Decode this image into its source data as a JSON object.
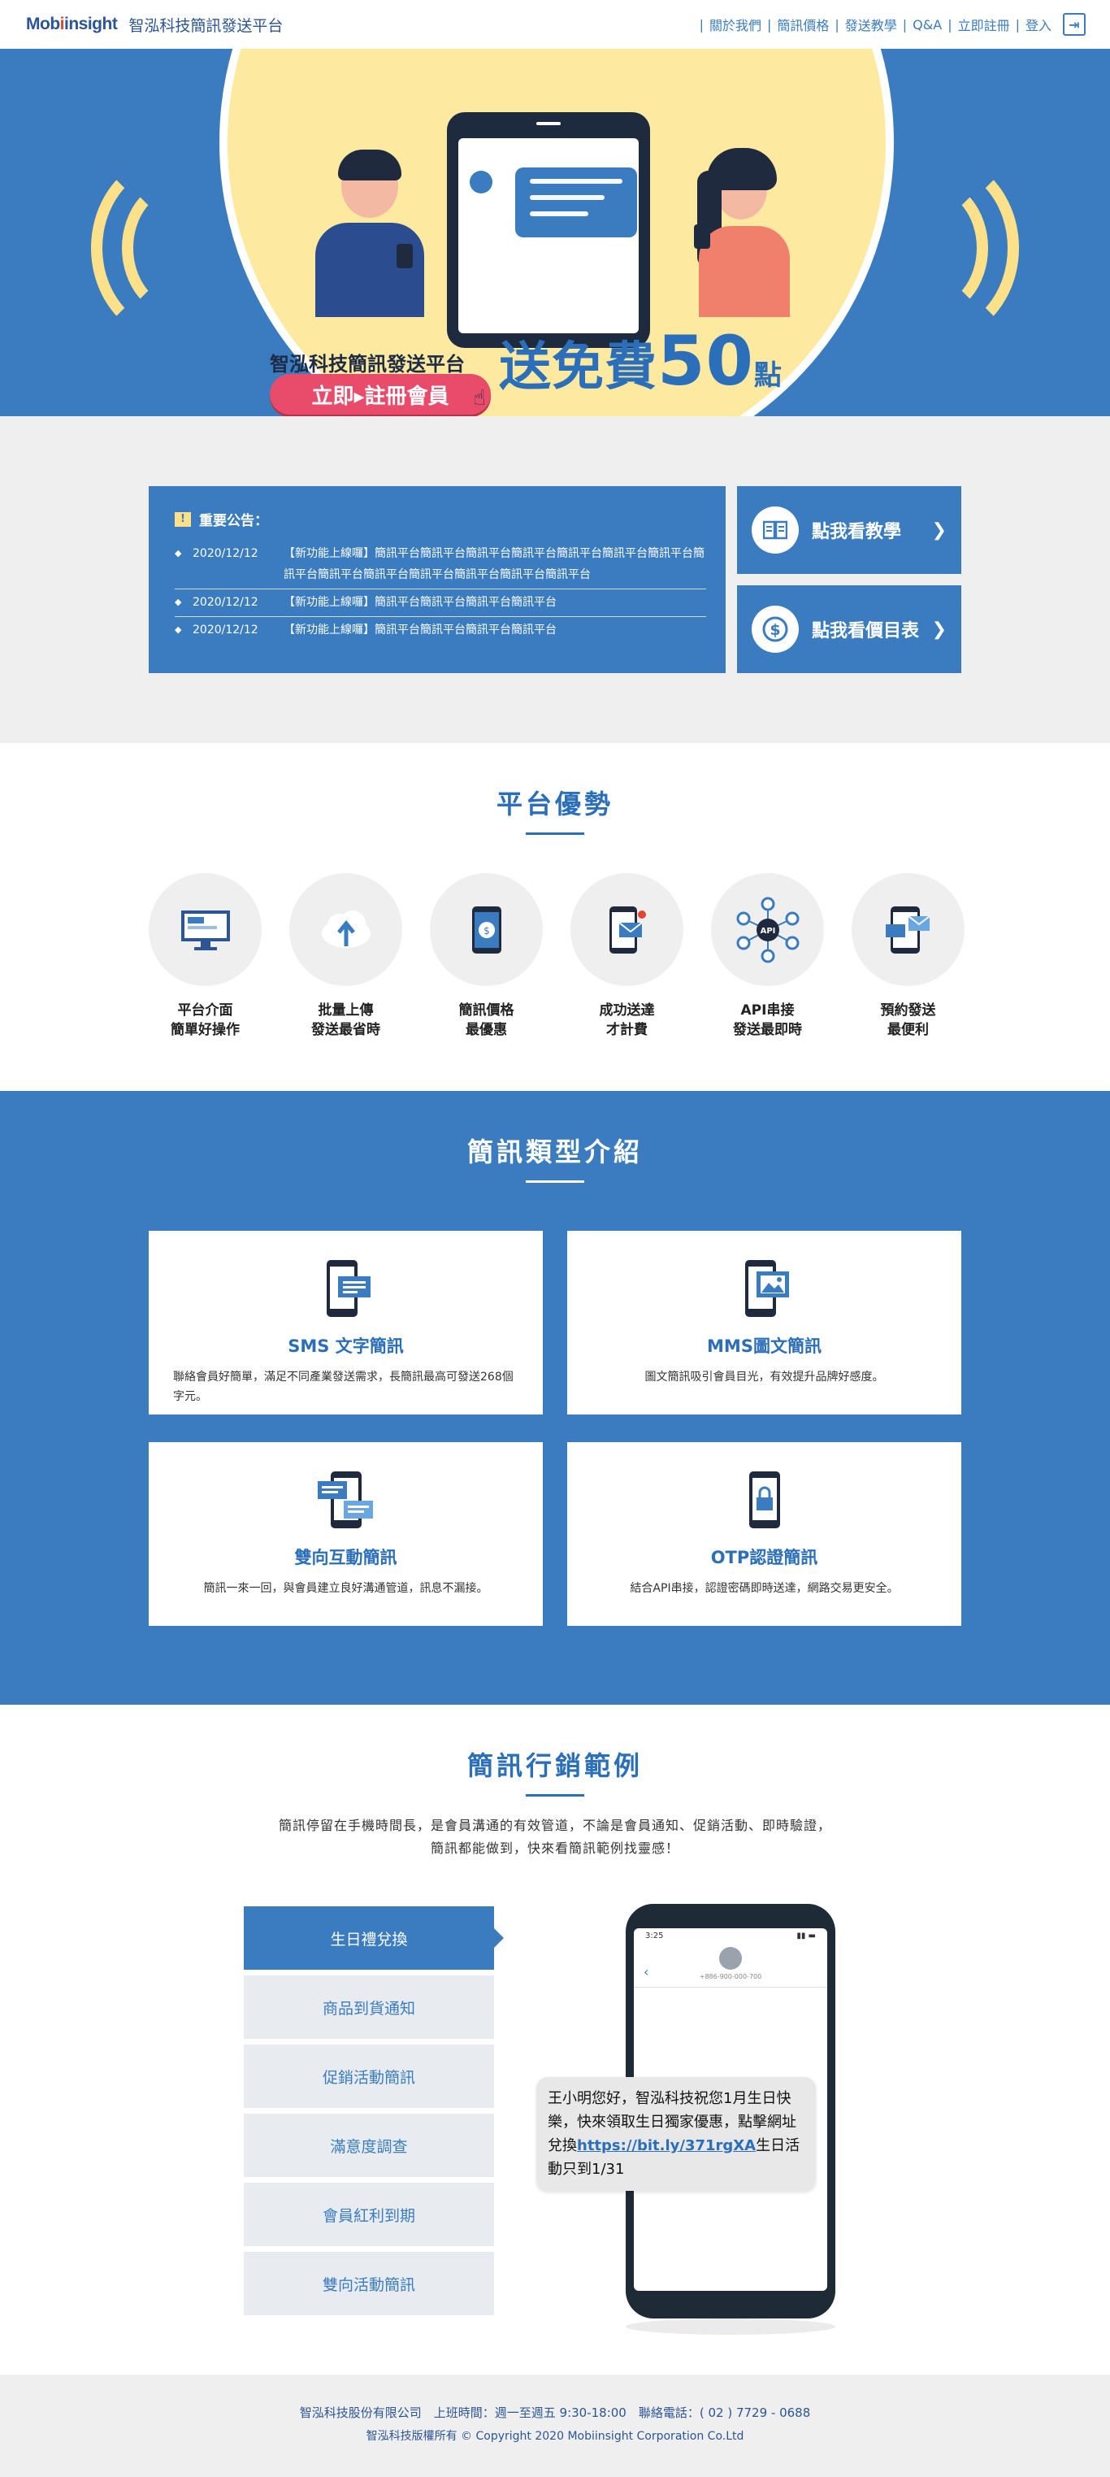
{
  "header": {
    "logo": "Mobiinsight",
    "site_title": "智泓科技簡訊發送平台",
    "nav": [
      "關於我們",
      "簡訊價格",
      "發送教學",
      "Q&A",
      "立即註冊",
      "登入"
    ]
  },
  "hero": {
    "tagline": "智泓科技簡訊發送平台",
    "cta": "立即▸註冊會員",
    "offer_prefix": "送免費",
    "offer_number": "50",
    "offer_unit": "點"
  },
  "notice": {
    "title": "重要公告：",
    "items": [
      {
        "date": "2020/12/12",
        "text": "【新功能上線囉】簡訊平台簡訊平台簡訊平台簡訊平台簡訊平台簡訊平台簡訊平台簡訊平台簡訊平台簡訊平台簡訊平台簡訊平台簡訊平台簡訊平台"
      },
      {
        "date": "2020/12/12",
        "text": "【新功能上線囉】簡訊平台簡訊平台簡訊平台簡訊平台"
      },
      {
        "date": "2020/12/12",
        "text": "【新功能上線囉】簡訊平台簡訊平台簡訊平台簡訊平台"
      }
    ],
    "side_buttons": [
      {
        "label": "點我看教學",
        "icon": "book-icon"
      },
      {
        "label": "點我看價目表",
        "icon": "dollar-icon"
      }
    ]
  },
  "advantages": {
    "title": "平台優勢",
    "items": [
      {
        "line1": "平台介面",
        "line2": "簡單好操作",
        "icon": "monitor-icon"
      },
      {
        "line1": "批量上傳",
        "line2": "發送最省時",
        "icon": "cloud-upload-icon"
      },
      {
        "line1": "簡訊價格",
        "line2": "最優惠",
        "icon": "phone-coin-icon"
      },
      {
        "line1": "成功送達",
        "line2": "才計費",
        "icon": "phone-mail-icon"
      },
      {
        "line1": "API串接",
        "line2": "發送最即時",
        "icon": "api-network-icon"
      },
      {
        "line1": "預約發送",
        "line2": "最便利",
        "icon": "phone-schedule-icon"
      }
    ]
  },
  "types": {
    "title": "簡訊類型介紹",
    "cards": [
      {
        "name": "SMS 文字簡訊",
        "desc": "聯絡會員好簡單，滿足不同產業發送需求，長簡訊最高可發送268個字元。",
        "icon": "sms-phone-icon"
      },
      {
        "name": "MMS圖文簡訊",
        "desc": "圖文簡訊吸引會員目光，有效提升品牌好感度。",
        "icon": "mms-phone-icon"
      },
      {
        "name": "雙向互動簡訊",
        "desc": "簡訊一來一回，與會員建立良好溝通管道，訊息不漏接。",
        "icon": "chat-phone-icon"
      },
      {
        "name": "OTP認證簡訊",
        "desc": "結合API串接，認證密碼即時送達，網路交易更安全。",
        "icon": "lock-phone-icon"
      }
    ]
  },
  "examples": {
    "title": "簡訊行銷範例",
    "intro_line1": "簡訊停留在手機時間長，是會員溝通的有效管道，不論是會員通知、促銷活動、即時驗證，",
    "intro_line2": "簡訊都能做到，快來看簡訊範例找靈感！",
    "tabs": [
      "生日禮兌換",
      "商品到貨通知",
      "促銷活動簡訊",
      "滿意度調查",
      "會員紅利到期",
      "雙向活動簡訊"
    ],
    "active_tab": 0,
    "phone_time": "3:25",
    "phone_number": "+886-900-000-700",
    "message_before": "王小明您好，智泓科技祝您1月生日快樂，快來領取生日獨家優惠，點擊網址兌換",
    "message_link": "https://bit.ly/371rgXA",
    "message_after": "生日活動只到1/31"
  },
  "footer": {
    "line1": "智泓科技股份有限公司　上班時間：週一至週五 9:30-18:00　聯絡電話：( 02 ) 7729 - 0688",
    "line2": "智泓科技版權所有 © Copyright 2020 Mobiinsight Corporation Co.Ltd"
  },
  "colors": {
    "primary": "#3a7cbf",
    "brand_dark": "#2b5597",
    "hero_yellow": "#fde9a0",
    "cta_pink": "#e94b6b",
    "light_bg": "#efefef"
  }
}
